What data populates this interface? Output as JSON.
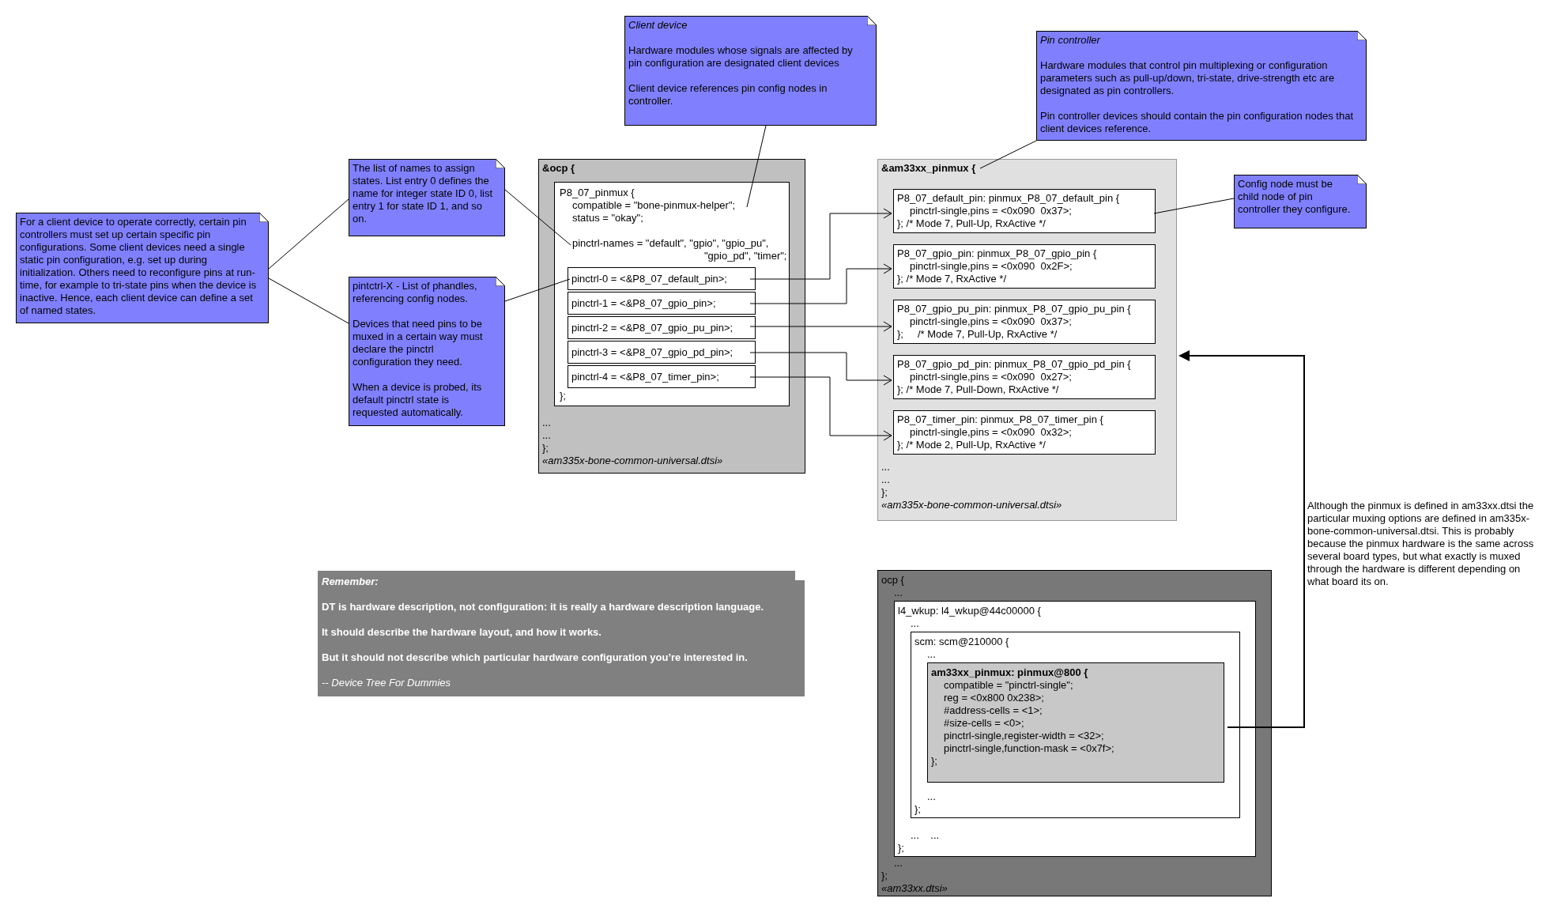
{
  "notes": [
    {
      "kind": "plain",
      "paragraphs": [
        "For a client device to operate correctly, certain pin controllers must set up certain specific pin configurations. Some client devices need a single static pin configuration, e.g. set up during initialization. Others need to reconfigure pins at run-time, for example to tri-state pins when the device is inactive. Hence, each client device can define a set of named states."
      ]
    },
    {
      "kind": "plain",
      "paragraphs": [
        "The list of names to assign states. List entry 0 defines the name for integer state ID 0, list entry 1 for state ID 1, and so on."
      ]
    },
    {
      "kind": "plain",
      "paragraphs": [
        "pintctrl-X - List of phandles, referencing config nodes.",
        "Devices that need pins to be muxed in a certain way must declare the pinctrl configuration they need.",
        "When a device is probed, its default pinctrl state is requested automatically."
      ]
    },
    {
      "kind": "titled",
      "title": "Client device",
      "paragraphs": [
        "Hardware modules whose signals are affected by pin configuration are designated client devices",
        "Client device references pin config nodes in controller."
      ]
    },
    {
      "kind": "titled",
      "title": "Pin controller",
      "paragraphs": [
        "Hardware modules that control pin multiplexing or configuration parameters such as pull-up/down, tri-state, drive-strength etc are designated as pin controllers.",
        "Pin controller devices should contain the pin configuration nodes that client devices reference."
      ]
    },
    {
      "kind": "plain",
      "paragraphs": [
        "Config node must be child node of pin controller they configure."
      ]
    },
    {
      "kind": "quote",
      "title": "Remember:",
      "paragraphs": [
        "DT is hardware description, not configuration: it is really a hardware description language.",
        "It should describe the hardware layout, and how it works.",
        "But it should not describe which particular hardware configuration you’re interested in."
      ],
      "attribution": "-- Device Tree For Dummies"
    }
  ],
  "client_node": {
    "title": "&ocp {",
    "child": {
      "header": "P8_07_pinmux {",
      "lines": [
        "compatible = \"bone-pinmux-helper\";",
        "status = \"okay\";"
      ],
      "names": [
        "pinctrl-names = \"default\", \"gpio\", \"gpio_pu\",",
        "\"gpio_pd\", \"timer\";"
      ],
      "entries": [
        "pinctrl-0 = <&P8_07_default_pin>;",
        "pinctrl-1 = <&P8_07_gpio_pin>;",
        "pinctrl-2 = <&P8_07_gpio_pu_pin>;",
        "pinctrl-3 = <&P8_07_gpio_pd_pin>;",
        "pinctrl-4 = <&P8_07_timer_pin>;"
      ],
      "footer": "};"
    },
    "after": [
      "...",
      "...",
      "};"
    ],
    "file": "«am335x-bone-common-universal.dtsi»"
  },
  "controller_node": {
    "title": "&am33xx_pinmux {",
    "configs": [
      {
        "header": "P8_07_default_pin: pinmux_P8_07_default_pin {",
        "line": "pinctrl-single,pins = <0x090  0x37>;",
        "footer": "}; /* Mode 7, Pull-Up, RxActive */"
      },
      {
        "header": "P8_07_gpio_pin: pinmux_P8_07_gpio_pin {",
        "line": "pinctrl-single,pins = <0x090  0x2F>;",
        "footer": "}; /* Mode 7, RxActive */"
      },
      {
        "header": "P8_07_gpio_pu_pin: pinmux_P8_07_gpio_pu_pin {",
        "line": "pinctrl-single,pins = <0x090  0x37>;",
        "footer": "};     /* Mode 7, Pull-Up, RxActive */"
      },
      {
        "header": "P8_07_gpio_pd_pin: pinmux_P8_07_gpio_pd_pin {",
        "line": "pinctrl-single,pins = <0x090  0x27>;",
        "footer": "}; /* Mode 7, Pull-Down, RxActive */"
      },
      {
        "header": "P8_07_timer_pin: pinmux_P8_07_timer_pin {",
        "line": "pinctrl-single,pins = <0x090  0x32>;",
        "footer": "}; /* Mode 2, Pull-Up, RxActive */"
      }
    ],
    "after": [
      "...",
      "...",
      "};"
    ],
    "file": "«am335x-bone-common-universal.dtsi»"
  },
  "annotation": "Although the pinmux is defined in am33xx.dtsi the particular muxing options are defined in am335x-bone-common-universal.dtsi. This is probably because the pinmux hardware is the same across several board types, but what exactly is muxed through the hardware is different depending on what board its on.",
  "soc_node": {
    "header": "ocp {",
    "before": [
      "..."
    ],
    "child": {
      "header": "l4_wkup: l4_wkup@44c00000 {",
      "before": [
        "..."
      ],
      "child": {
        "header": "scm: scm@210000 {",
        "before": [
          "..."
        ],
        "pinmux": {
          "header": "am33xx_pinmux: pinmux@800 {",
          "lines": [
            "compatible = \"pinctrl-single\";",
            "reg = <0x800 0x238>;",
            "#address-cells = <1>;",
            "#size-cells = <0>;",
            "pinctrl-single,register-width = <32>;",
            "pinctrl-single,function-mask = <0x7f>;"
          ],
          "footer": "};"
        },
        "after": [
          "..."
        ],
        "footer": "};"
      },
      "after": [
        "...    ..."
      ],
      "footer": "};"
    },
    "after": [
      "..."
    ],
    "footer": "};",
    "file": "«am33xx.dtsi»"
  }
}
